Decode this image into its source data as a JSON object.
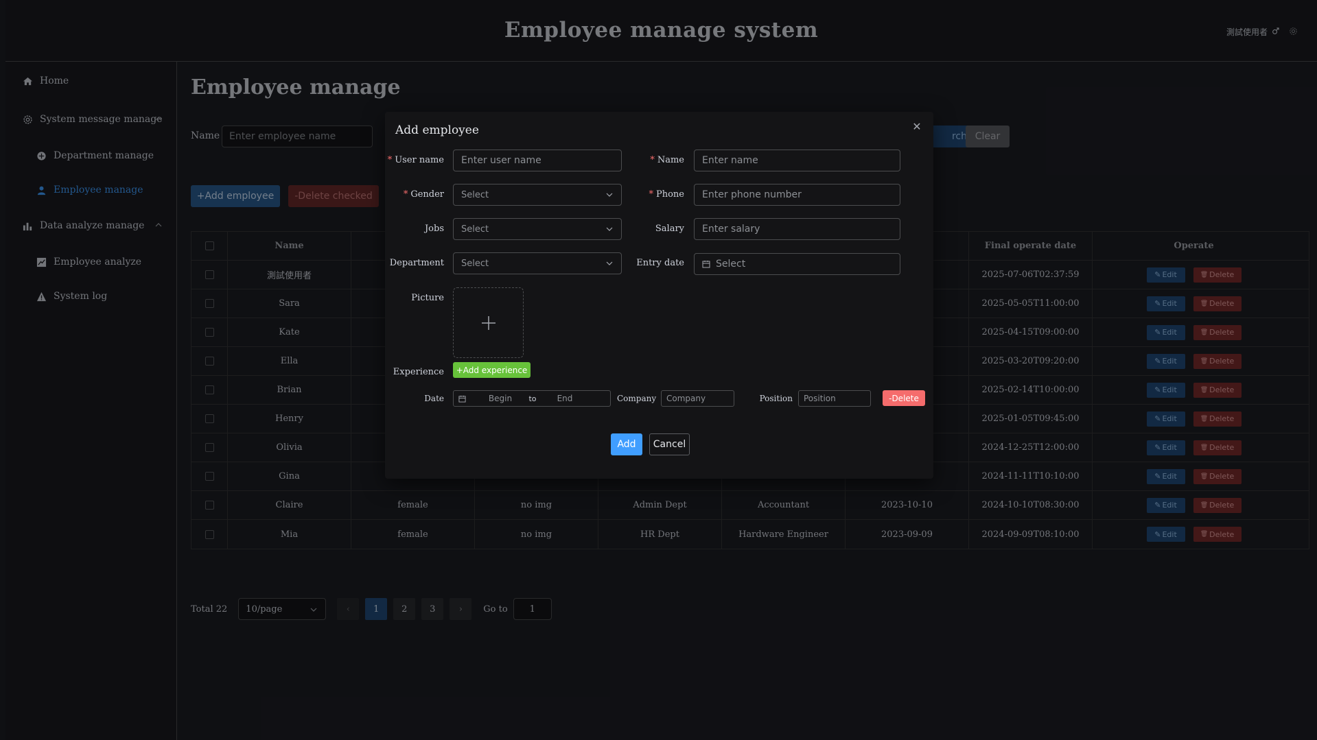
{
  "header": {
    "app_title": "Employee manage system",
    "username": "測試使用者"
  },
  "sidebar": {
    "items": [
      {
        "label": "Home"
      },
      {
        "label": "System message manage"
      },
      {
        "label": "Department manage"
      },
      {
        "label": "Employee manage"
      },
      {
        "label": "Data analyze manage"
      },
      {
        "label": "Employee analyze"
      },
      {
        "label": "System log"
      }
    ]
  },
  "main": {
    "page_title": "Employee manage",
    "filter": {
      "name_label": "Name",
      "name_placeholder": "Enter employee name",
      "search_label": "rch",
      "clear_label": "Clear"
    },
    "actions": {
      "add_label": "+Add employee",
      "delete_checked_label": "-Delete checked"
    }
  },
  "table": {
    "headers": [
      "Name",
      "",
      "",
      "",
      "",
      "",
      "Final operate date",
      "Operate"
    ],
    "edit_label": "Edit",
    "delete_label": "Delete",
    "rows": [
      {
        "name": "測試使用者",
        "gender": "",
        "picture": "",
        "dept": "",
        "job": "",
        "entry": "",
        "final": "2025-07-06T02:37:59"
      },
      {
        "name": "Sara",
        "gender": "",
        "picture": "",
        "dept": "",
        "job": "",
        "entry": "",
        "final": "2025-05-05T11:00:00"
      },
      {
        "name": "Kate",
        "gender": "",
        "picture": "",
        "dept": "",
        "job": "",
        "entry": "",
        "final": "2025-04-15T09:00:00"
      },
      {
        "name": "Ella",
        "gender": "",
        "picture": "",
        "dept": "",
        "job": "",
        "entry": "",
        "final": "2025-03-20T09:20:00"
      },
      {
        "name": "Brian",
        "gender": "",
        "picture": "",
        "dept": "",
        "job": "",
        "entry": "",
        "final": "2025-02-14T10:00:00"
      },
      {
        "name": "Henry",
        "gender": "",
        "picture": "",
        "dept": "",
        "job": "",
        "entry": "",
        "final": "2025-01-05T09:45:00"
      },
      {
        "name": "Olivia",
        "gender": "",
        "picture": "",
        "dept": "",
        "job": "",
        "entry": "",
        "final": "2024-12-25T12:00:00"
      },
      {
        "name": "Gina",
        "gender": "",
        "picture": "",
        "dept": "",
        "job": "",
        "entry": "",
        "final": "2024-11-11T10:10:00"
      },
      {
        "name": "Claire",
        "gender": "female",
        "picture": "no img",
        "dept": "Admin Dept",
        "job": "Accountant",
        "entry": "2023-10-10",
        "final": "2024-10-10T08:30:00"
      },
      {
        "name": "Mia",
        "gender": "female",
        "picture": "no img",
        "dept": "HR Dept",
        "job": "Hardware Engineer",
        "entry": "2023-09-09",
        "final": "2024-09-09T08:10:00"
      }
    ]
  },
  "pagination": {
    "total": "Total 22",
    "page_size": "10/page",
    "pages": [
      "1",
      "2",
      "3"
    ],
    "current": "1",
    "goto_label": "Go to",
    "goto_value": "1"
  },
  "dialog": {
    "title": "Add employee",
    "fields": {
      "username": {
        "label": "User name",
        "placeholder": "Enter user name"
      },
      "name": {
        "label": "Name",
        "placeholder": "Enter name"
      },
      "gender": {
        "label": "Gender",
        "placeholder": "Select"
      },
      "phone": {
        "label": "Phone",
        "placeholder": "Enter phone number"
      },
      "jobs": {
        "label": "Jobs",
        "placeholder": "Select"
      },
      "salary": {
        "label": "Salary",
        "placeholder": "Enter salary"
      },
      "department": {
        "label": "Department",
        "placeholder": "Select"
      },
      "entry_date": {
        "label": "Entry date",
        "placeholder": "Select"
      },
      "picture": {
        "label": "Picture"
      },
      "experience": {
        "label": "Experience",
        "add_label": "+Add experience"
      }
    },
    "experience_row": {
      "date_label": "Date",
      "begin": "Begin",
      "to": "to",
      "end": "End",
      "company_label": "Company",
      "company_placeholder": "Company",
      "position_label": "Position",
      "position_placeholder": "Position",
      "delete_label": "-Delete"
    },
    "add_label": "Add",
    "cancel_label": "Cancel"
  },
  "colors": {
    "accent": "#409eff",
    "danger": "#f56c6c",
    "success": "#67c23a",
    "background": "#1d1e24"
  }
}
